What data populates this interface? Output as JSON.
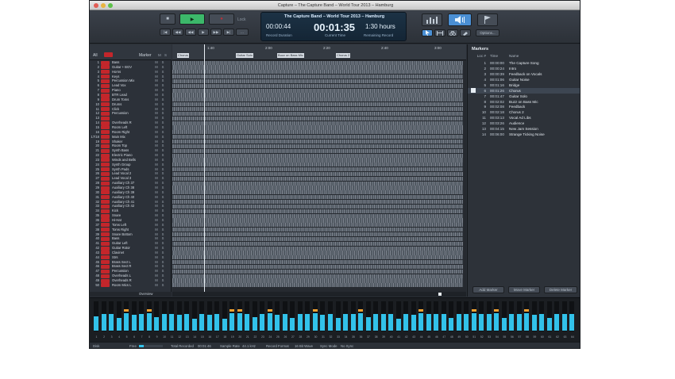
{
  "window": {
    "title": "Capture – The Capture Band – World Tour 2013 – Hamburg"
  },
  "toolbar": {
    "lock_label": "Lock",
    "options_label": "Options...",
    "transport": {
      "stop": "■",
      "play": "▶",
      "record": "●",
      "rewind_start": "|◀",
      "rewind": "◀◀",
      "rewind2": "◀◀",
      "forward": "▶",
      "forward2": "▶▶",
      "forward_end": "▶|"
    },
    "zoom_value": "…"
  },
  "display": {
    "title": "The Capture Band – World Tour 2013 – Hamburg",
    "record_duration": "00:00:44",
    "record_duration_label": "Record Duration",
    "current_time": "00:01:35",
    "current_time_label": "Current Time",
    "remaining": "1:30 hours",
    "remaining_label": "Remaining Record"
  },
  "tracks": {
    "header_all": "All",
    "header_marker": "Marker",
    "header_m": "M",
    "header_s": "S",
    "overview_label": "Overview",
    "mute_label": "M",
    "solo_label": "S",
    "items": [
      {
        "num": "1",
        "name": "Bass"
      },
      {
        "num": "2",
        "name": "Guitar + BGV"
      },
      {
        "num": "3",
        "name": "Horns"
      },
      {
        "num": "4",
        "name": "Keys"
      },
      {
        "num": "5",
        "name": "Percussion Mix"
      },
      {
        "num": "6",
        "name": "Lead Vox"
      },
      {
        "num": "7",
        "name": "Piano"
      },
      {
        "num": "8",
        "name": "BTR Lead"
      },
      {
        "num": "9",
        "name": "Drum Toms"
      },
      {
        "num": "10",
        "name": "Drums"
      },
      {
        "num": "11",
        "name": "Click"
      },
      {
        "num": "12",
        "name": "Percussion"
      },
      {
        "num": "13",
        "name": ""
      },
      {
        "num": "14",
        "name": "Overheads R"
      },
      {
        "num": "15",
        "name": "Room Left"
      },
      {
        "num": "16",
        "name": "Room Right"
      },
      {
        "num": "17/18",
        "name": "Main Mix"
      },
      {
        "num": "19",
        "name": "Shaker"
      },
      {
        "num": "20",
        "name": "Room Top"
      },
      {
        "num": "21",
        "name": "Synth Bass"
      },
      {
        "num": "22",
        "name": "Electric Piano"
      },
      {
        "num": "23",
        "name": "Winds and Bells"
      },
      {
        "num": "24",
        "name": "Synth Group"
      },
      {
        "num": "25",
        "name": "Synth Pads"
      },
      {
        "num": "26",
        "name": "Lead Vocal 2"
      },
      {
        "num": "27",
        "name": "Lead Vocal 3"
      },
      {
        "num": "28",
        "name": "Auxiliary Ch 37"
      },
      {
        "num": "29",
        "name": "Auxiliary Ch 38"
      },
      {
        "num": "30",
        "name": "Auxiliary Ch 39"
      },
      {
        "num": "31",
        "name": "Auxiliary Ch 40"
      },
      {
        "num": "32",
        "name": "Auxiliary Ch 41"
      },
      {
        "num": "33",
        "name": "Auxiliary Ch 42"
      },
      {
        "num": "34",
        "name": "Kick"
      },
      {
        "num": "35",
        "name": "Snare"
      },
      {
        "num": "36",
        "name": "Hi-Hat"
      },
      {
        "num": "37",
        "name": "Toms Left"
      },
      {
        "num": "38",
        "name": "Toms Right"
      },
      {
        "num": "39",
        "name": "Snare Bottom"
      },
      {
        "num": "40",
        "name": "Bass"
      },
      {
        "num": "41",
        "name": "Guitar Left"
      },
      {
        "num": "42",
        "name": "Guitar Rotor"
      },
      {
        "num": "43",
        "name": "Clavinet"
      },
      {
        "num": "44",
        "name": "Strs"
      },
      {
        "num": "45",
        "name": "Brass Sect L"
      },
      {
        "num": "46",
        "name": "Brass Sect R"
      },
      {
        "num": "47",
        "name": "Percussion"
      },
      {
        "num": "48",
        "name": "Overheads L"
      },
      {
        "num": "49",
        "name": "Overheads R"
      },
      {
        "num": "50",
        "name": "Room Mics L"
      }
    ]
  },
  "ruler": {
    "ticks": [
      "1:40",
      "2:00",
      "2:20",
      "2:40",
      "3:00"
    ],
    "flags": [
      "Chorus",
      "Guitar Solo",
      "Buzz on Bass Mic",
      "Chorus 2"
    ]
  },
  "markers": {
    "title": "Markers",
    "col_loc": "Loc #",
    "col_time": "Time",
    "col_name": "Name",
    "add_button": "Add Marker",
    "move_button": "Move Marker",
    "delete_button": "Delete Marker",
    "items": [
      {
        "loc": "1",
        "time": "00:00:00",
        "name": "The Capture Song"
      },
      {
        "loc": "2",
        "time": "00:00:24",
        "name": "Intro"
      },
      {
        "loc": "3",
        "time": "00:00:39",
        "name": "Feedback on Vocals"
      },
      {
        "loc": "4",
        "time": "00:01:06",
        "name": "Guitar Noise"
      },
      {
        "loc": "5",
        "time": "00:01:16",
        "name": "Bridge"
      },
      {
        "loc": "6",
        "time": "00:01:26",
        "name": "Chorus"
      },
      {
        "loc": "7",
        "time": "00:01:47",
        "name": "Guitar Solo"
      },
      {
        "loc": "8",
        "time": "00:02:02",
        "name": "Buzz on Bass Mic"
      },
      {
        "loc": "9",
        "time": "00:02:08",
        "name": "Feedback"
      },
      {
        "loc": "10",
        "time": "00:02:18",
        "name": "Chorus 2"
      },
      {
        "loc": "11",
        "time": "00:03:13",
        "name": "Vocal Ad Libs"
      },
      {
        "loc": "12",
        "time": "00:03:26",
        "name": "Audience"
      },
      {
        "loc": "13",
        "time": "00:04:15",
        "name": "New Jam Session"
      },
      {
        "loc": "14",
        "time": "00:06:00",
        "name": "Strange Ticking Noise"
      }
    ]
  },
  "meters": {
    "channels": [
      "1",
      "2",
      "3",
      "4",
      "5",
      "6",
      "7",
      "8",
      "9",
      "10",
      "11",
      "12",
      "13",
      "14",
      "15",
      "16",
      "17",
      "18",
      "19",
      "20",
      "21",
      "22",
      "23",
      "24",
      "25",
      "26",
      "27",
      "28",
      "29",
      "30",
      "31",
      "32",
      "33",
      "34",
      "35",
      "36",
      "37",
      "38",
      "39",
      "40",
      "41",
      "42",
      "43",
      "44",
      "45",
      "46",
      "47",
      "48",
      "49",
      "50",
      "51",
      "52",
      "53",
      "54",
      "55",
      "56",
      "57",
      "58",
      "59",
      "60",
      "61",
      "62",
      "63",
      "64"
    ],
    "levels": [
      0.62,
      0.72,
      0.7,
      0.55,
      0.74,
      0.66,
      0.71,
      0.73,
      0.58,
      0.71,
      0.7,
      0.69,
      0.72,
      0.5,
      0.72,
      0.67,
      0.7,
      0.52,
      0.73,
      0.74,
      0.71,
      0.56,
      0.7,
      0.73,
      0.69,
      0.71,
      0.53,
      0.72,
      0.7,
      0.74,
      0.66,
      0.72,
      0.55,
      0.7,
      0.71,
      0.73,
      0.58,
      0.72,
      0.7,
      0.71,
      0.52,
      0.7,
      0.66,
      0.73,
      0.72,
      0.71,
      0.7,
      0.53,
      0.72,
      0.7,
      0.75,
      0.71,
      0.72,
      0.74,
      0.55,
      0.72,
      0.7,
      0.73,
      0.69,
      0.72,
      0.54,
      0.71,
      0.7,
      0.72
    ],
    "peak_color": "#f0a030",
    "level_color": "#32c2ea"
  },
  "status": {
    "disk_label": "Disk",
    "free_label": "Free",
    "total_recorded_label": "Total Recorded",
    "total_recorded": "00:01:46",
    "sample_rate_label": "Sample Rate",
    "sample_rate": "44.1 kHz",
    "record_format_label": "Record Format",
    "record_format": "16 Bit Wave",
    "sync_mode_label": "Sync Mode",
    "sync_mode": "No Sync"
  }
}
